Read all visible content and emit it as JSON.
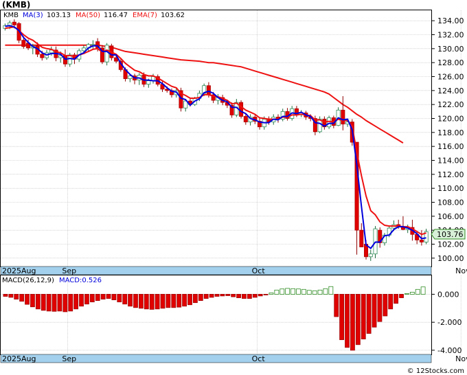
{
  "ticker_label": "(KMB)",
  "legend": {
    "symbol": "KMB",
    "ma3": "MA(3)",
    "ma3_val": "103.13",
    "ma50": "MA(50)",
    "ma50_val": "116.47",
    "ema7": "EMA(7)",
    "ema7_val": "103.62"
  },
  "last_price_label": "103.76",
  "macd_legend": {
    "params": "MACD(26,12,9)",
    "value": "MACD:0.526"
  },
  "watermark": "© 12Stocks.com",
  "colors": {
    "up_candle": "#2e8b57",
    "down_candle": "#e00000",
    "ma3": "#0000dd",
    "ma50": "#ee1111",
    "ema7": "#ee1111",
    "macd_pos": "#2e8b22",
    "macd_neg": "#e00000",
    "month_band": "#a3d0ec",
    "grid": "#b8b8b8"
  },
  "chart_data": [
    {
      "type": "candlestick",
      "ylim": [
        99,
        135
      ],
      "y_ticks": [
        "100.00",
        "102.00",
        "104.00",
        "106.00",
        "108.00",
        "110.00",
        "112.00",
        "114.00",
        "116.00",
        "118.00",
        "120.00",
        "122.00",
        "124.00",
        "126.00",
        "128.00",
        "130.00",
        "132.00",
        "134.00"
      ],
      "x_labels": [
        {
          "label": "2025Aug",
          "bar": 0
        },
        {
          "label": "Sep",
          "bar": 14
        },
        {
          "label": "Oct",
          "bar": 55
        },
        {
          "label": "Nov",
          "bar": 99
        }
      ],
      "candles": [
        [
          132.9,
          133.6,
          132.6,
          133.3
        ],
        [
          133.2,
          134.0,
          132.8,
          133.7
        ],
        [
          133.8,
          134.2,
          132.9,
          133.4
        ],
        [
          133.6,
          133.8,
          130.8,
          131.2
        ],
        [
          131.2,
          131.8,
          130.0,
          130.3
        ],
        [
          130.8,
          131.3,
          129.8,
          130.1
        ],
        [
          130.1,
          130.7,
          129.2,
          130.4
        ],
        [
          130.4,
          130.9,
          128.8,
          129.2
        ],
        [
          129.2,
          129.7,
          128.3,
          128.7
        ],
        [
          128.7,
          129.8,
          128.4,
          129.4
        ],
        [
          129.4,
          130.3,
          129.0,
          129.8
        ],
        [
          129.8,
          130.3,
          128.2,
          128.7
        ],
        [
          128.7,
          129.6,
          128.0,
          129.0
        ],
        [
          129.0,
          129.9,
          127.4,
          127.8
        ],
        [
          127.8,
          129.4,
          127.4,
          129.1
        ],
        [
          129.1,
          129.4,
          127.8,
          128.5
        ],
        [
          128.5,
          130.0,
          128.1,
          129.7
        ],
        [
          129.7,
          130.5,
          129.2,
          130.1
        ],
        [
          130.1,
          130.8,
          129.6,
          130.6
        ],
        [
          130.6,
          131.2,
          130.0,
          130.6
        ],
        [
          131.0,
          131.5,
          129.6,
          130.1
        ],
        [
          130.1,
          130.5,
          127.8,
          128.1
        ],
        [
          128.1,
          130.8,
          127.6,
          130.5
        ],
        [
          130.4,
          130.7,
          128.3,
          128.7
        ],
        [
          128.7,
          129.0,
          127.9,
          128.2
        ],
        [
          128.2,
          128.5,
          126.7,
          127.0
        ],
        [
          127.0,
          127.3,
          125.3,
          125.7
        ],
        [
          125.7,
          126.4,
          125.2,
          126.1
        ],
        [
          126.1,
          126.4,
          124.9,
          125.5
        ],
        [
          125.5,
          126.5,
          124.8,
          126.2
        ],
        [
          126.2,
          126.6,
          124.5,
          124.9
        ],
        [
          124.9,
          125.7,
          124.4,
          125.4
        ],
        [
          125.4,
          126.4,
          125.0,
          126.0
        ],
        [
          126.0,
          126.3,
          124.6,
          124.9
        ],
        [
          124.9,
          125.3,
          123.8,
          124.2
        ],
        [
          124.2,
          124.6,
          123.7,
          124.0
        ],
        [
          124.0,
          124.3,
          123.0,
          123.4
        ],
        [
          123.4,
          124.3,
          123.0,
          124.0
        ],
        [
          124.0,
          124.4,
          121.0,
          121.5
        ],
        [
          121.5,
          122.7,
          121.0,
          122.5
        ],
        [
          122.5,
          122.9,
          121.7,
          122.0
        ],
        [
          122.0,
          123.1,
          121.8,
          122.9
        ],
        [
          122.9,
          124.0,
          122.5,
          123.6
        ],
        [
          123.6,
          125.0,
          123.2,
          124.7
        ],
        [
          124.7,
          125.2,
          123.0,
          123.4
        ],
        [
          123.4,
          123.8,
          122.2,
          122.6
        ],
        [
          122.6,
          123.5,
          122.0,
          123.0
        ],
        [
          123.0,
          123.4,
          121.9,
          122.3
        ],
        [
          122.3,
          122.7,
          121.5,
          121.9
        ],
        [
          121.9,
          122.3,
          120.1,
          120.5
        ],
        [
          120.5,
          122.8,
          120.2,
          122.3
        ],
        [
          122.3,
          122.6,
          120.0,
          120.3
        ],
        [
          120.3,
          120.7,
          119.1,
          119.5
        ],
        [
          119.5,
          120.6,
          119.0,
          120.2
        ],
        [
          120.2,
          120.5,
          119.2,
          119.6
        ],
        [
          119.6,
          120.0,
          118.4,
          118.8
        ],
        [
          118.8,
          120.3,
          118.4,
          119.9
        ],
        [
          119.9,
          120.3,
          119.1,
          119.5
        ],
        [
          119.5,
          120.6,
          119.1,
          120.2
        ],
        [
          120.2,
          120.6,
          119.4,
          119.9
        ],
        [
          119.9,
          121.4,
          119.6,
          121.0
        ],
        [
          121.0,
          121.5,
          119.7,
          120.0
        ],
        [
          120.0,
          121.8,
          119.7,
          121.4
        ],
        [
          121.4,
          121.8,
          120.2,
          120.6
        ],
        [
          120.6,
          121.2,
          120.2,
          120.8
        ],
        [
          120.8,
          121.1,
          119.8,
          120.2
        ],
        [
          120.2,
          120.6,
          119.6,
          120.0
        ],
        [
          120.0,
          120.4,
          117.6,
          118.1
        ],
        [
          118.1,
          120.3,
          117.9,
          119.9
        ],
        [
          119.9,
          120.3,
          118.4,
          118.8
        ],
        [
          118.8,
          120.4,
          118.5,
          120.1
        ],
        [
          120.1,
          120.4,
          118.6,
          119.0
        ],
        [
          119.0,
          121.6,
          118.9,
          121.2
        ],
        [
          121.2,
          123.2,
          118.3,
          119.2
        ],
        [
          119.2,
          120.0,
          118.8,
          119.5
        ],
        [
          119.5,
          119.9,
          116.1,
          116.6
        ],
        [
          116.6,
          106.5,
          100.5,
          104.0
        ],
        [
          104.0,
          105.0,
          102.9,
          101.6
        ],
        [
          102.0,
          102.6,
          99.8,
          100.2
        ],
        [
          100.2,
          101.2,
          99.6,
          100.6
        ],
        [
          100.6,
          104.6,
          100.0,
          104.2
        ],
        [
          104.0,
          104.4,
          101.5,
          102.2
        ],
        [
          102.2,
          103.6,
          101.8,
          103.3
        ],
        [
          103.3,
          104.5,
          103.0,
          104.3
        ],
        [
          104.3,
          105.4,
          103.9,
          104.8
        ],
        [
          104.8,
          105.5,
          104.2,
          104.5
        ],
        [
          104.5,
          106.0,
          104.0,
          104.1
        ],
        [
          104.1,
          104.8,
          103.6,
          104.4
        ],
        [
          104.4,
          105.5,
          102.5,
          103.4
        ],
        [
          103.4,
          103.9,
          102.0,
          102.6
        ],
        [
          102.6,
          104.0,
          101.8,
          102.3
        ],
        [
          102.3,
          104.2,
          102.0,
          103.8
        ]
      ],
      "ma3": [
        133.2,
        133.3,
        133.1,
        132.6,
        131.6,
        130.9,
        130.3,
        130.0,
        129.4,
        129.1,
        129.3,
        129.3,
        129.2,
        128.5,
        128.6,
        128.5,
        129.1,
        129.4,
        130.1,
        130.4,
        130.4,
        129.6,
        129.6,
        129.1,
        129.1,
        127.9,
        127.0,
        126.3,
        125.8,
        125.8,
        125.5,
        125.5,
        125.4,
        125.4,
        125.0,
        124.4,
        123.9,
        123.8,
        122.9,
        122.7,
        121.9,
        122.5,
        122.8,
        123.7,
        123.9,
        123.6,
        123.0,
        122.6,
        122.4,
        121.6,
        121.6,
        121.0,
        120.7,
        120.0,
        119.8,
        119.5,
        119.4,
        119.4,
        119.9,
        119.8,
        120.3,
        120.3,
        120.8,
        120.7,
        120.9,
        120.5,
        120.3,
        119.4,
        119.3,
        118.9,
        119.3,
        119.3,
        120.1,
        119.8,
        119.9,
        118.4,
        113.4,
        107.4,
        101.9,
        101.4,
        102.3,
        102.3,
        103.2,
        103.3,
        104.1,
        104.5,
        104.5,
        104.3,
        104.0,
        103.5,
        102.8,
        102.9
      ],
      "ma50": [
        130.5,
        130.5,
        130.5,
        130.5,
        130.5,
        130.5,
        130.5,
        130.5,
        130.5,
        130.5,
        130.5,
        130.5,
        130.5,
        130.5,
        130.5,
        130.5,
        130.5,
        130.5,
        130.5,
        130.5,
        130.5,
        130.4,
        130.3,
        130.2,
        130.0,
        129.8,
        129.6,
        129.5,
        129.4,
        129.3,
        129.2,
        129.1,
        129.0,
        128.9,
        128.8,
        128.7,
        128.6,
        128.5,
        128.4,
        128.35,
        128.3,
        128.25,
        128.2,
        128.1,
        128.0,
        128.0,
        127.9,
        127.8,
        127.7,
        127.6,
        127.5,
        127.4,
        127.2,
        127.0,
        126.8,
        126.6,
        126.4,
        126.2,
        126.0,
        125.8,
        125.6,
        125.4,
        125.2,
        125.0,
        124.8,
        124.6,
        124.4,
        124.2,
        124.0,
        123.8,
        123.5,
        123.0,
        122.5,
        122.0,
        121.6,
        121.1,
        120.6,
        120.2,
        119.7,
        119.3,
        118.9,
        118.5,
        118.1,
        117.7,
        117.3,
        116.9,
        116.5
      ],
      "ma50_start": 0,
      "ema7": [
        132.9,
        133.0,
        133.1,
        132.6,
        132.0,
        131.5,
        131.2,
        130.7,
        130.2,
        130.0,
        129.9,
        129.6,
        129.4,
        129.0,
        129.0,
        128.9,
        129.1,
        129.3,
        129.6,
        129.9,
        130.0,
        129.5,
        129.8,
        129.5,
        129.2,
        128.6,
        127.9,
        127.4,
        126.9,
        126.7,
        126.3,
        126.1,
        126.1,
        125.8,
        125.4,
        125.0,
        124.6,
        124.4,
        123.6,
        123.3,
        122.9,
        122.9,
        123.0,
        123.4,
        123.4,
        123.2,
        123.1,
        122.9,
        122.6,
        122.1,
        122.2,
        121.7,
        121.2,
        120.9,
        120.6,
        120.1,
        120.0,
        119.9,
        119.9,
        119.9,
        120.2,
        120.2,
        120.5,
        120.5,
        120.6,
        120.5,
        120.4,
        119.8,
        119.8,
        119.5,
        119.6,
        119.5,
        119.9,
        119.7,
        119.7,
        118.9,
        115.2,
        111.8,
        108.9,
        106.8,
        106.2,
        105.2,
        104.7,
        104.6,
        104.6,
        104.6,
        104.5,
        104.5,
        104.2,
        103.8,
        103.4,
        103.6
      ]
    },
    {
      "type": "bar",
      "ylim": [
        -4.2,
        1.2
      ],
      "y_ticks": [
        "0.000",
        "-2.000",
        "-4.000"
      ],
      "values": [
        -0.15,
        -0.22,
        -0.35,
        -0.5,
        -0.72,
        -0.9,
        -1.05,
        -1.15,
        -1.2,
        -1.22,
        -1.2,
        -1.25,
        -1.2,
        -1.05,
        -0.85,
        -0.7,
        -0.55,
        -0.45,
        -0.35,
        -0.3,
        -0.4,
        -0.55,
        -0.7,
        -0.85,
        -0.95,
        -1.0,
        -1.05,
        -1.08,
        -1.05,
        -1.0,
        -0.95,
        -0.95,
        -0.92,
        -0.85,
        -0.75,
        -0.6,
        -0.45,
        -0.3,
        -0.22,
        -0.15,
        -0.12,
        -0.1,
        -0.18,
        -0.25,
        -0.3,
        -0.3,
        -0.22,
        -0.12,
        -0.05,
        0.1,
        0.3,
        0.38,
        0.42,
        0.4,
        0.38,
        0.35,
        0.28,
        0.25,
        0.3,
        0.4,
        0.55,
        -1.6,
        -3.25,
        -3.8,
        -4.0,
        -3.6,
        -3.2,
        -2.8,
        -2.35,
        -1.95,
        -1.55,
        -1.05,
        -0.65,
        -0.25,
        0.05,
        0.15,
        0.35,
        0.526
      ]
    }
  ]
}
